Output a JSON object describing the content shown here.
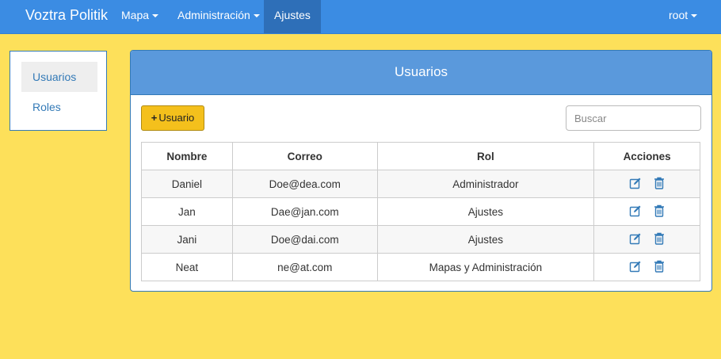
{
  "navbar": {
    "brand": "Voztra Politik",
    "items": [
      {
        "label": "Mapa"
      },
      {
        "label": "Administración"
      },
      {
        "label": "Ajustes"
      }
    ],
    "user": "root"
  },
  "sidebar": {
    "items": [
      {
        "label": "Usuarios"
      },
      {
        "label": "Roles"
      }
    ]
  },
  "panel": {
    "title": "Usuarios",
    "add_label": "Usuario",
    "search_placeholder": "Buscar"
  },
  "table": {
    "headers": [
      "Nombre",
      "Correo",
      "Rol",
      "Acciones"
    ],
    "rows": [
      {
        "nombre": "Daniel",
        "correo": "Doe@dea.com",
        "rol": "Administrador"
      },
      {
        "nombre": "Jan",
        "correo": "Dae@jan.com",
        "rol": "Ajustes"
      },
      {
        "nombre": "Jani",
        "correo": "Doe@dai.com",
        "rol": "Ajustes"
      },
      {
        "nombre": "Neat",
        "correo": "ne@at.com",
        "rol": "Mapas y Administración"
      }
    ]
  },
  "icons": {
    "add": "plus-icon",
    "edit": "edit-icon",
    "delete": "trash-icon"
  },
  "colors": {
    "navbar": "#3b8ce3",
    "background": "#fde05a",
    "panel_heading": "#5a99dc",
    "add_button": "#f4c01c",
    "link": "#337ab7"
  }
}
